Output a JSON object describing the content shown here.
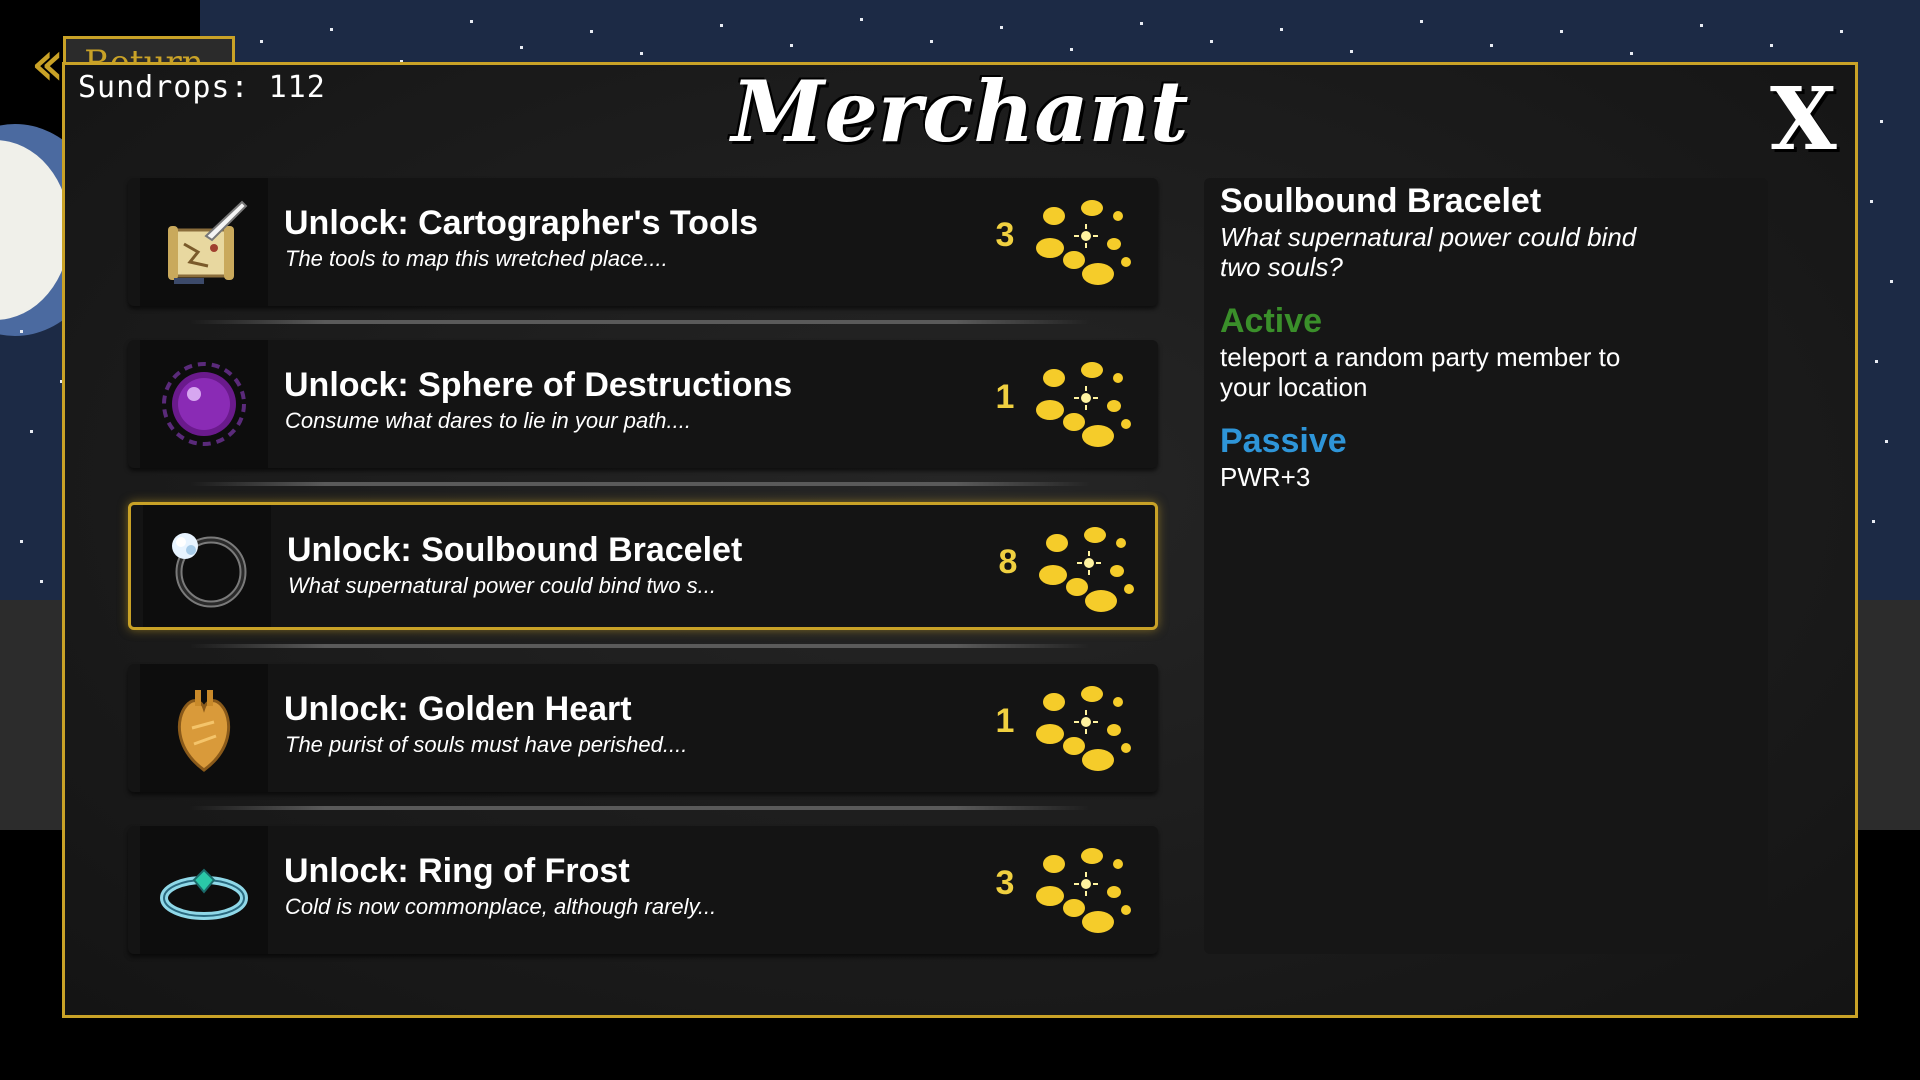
{
  "header": {
    "sundrops_label": "Sundrops: 112",
    "title": "Merchant",
    "close_label": "X"
  },
  "return_button": {
    "label": "Return"
  },
  "shop_items": [
    {
      "name": "Unlock: Cartographer's Tools",
      "description": "The tools to map this wretched place....",
      "price": "3",
      "icon": "map-and-quill-icon",
      "selected": false
    },
    {
      "name": "Unlock: Sphere of Destructions",
      "description": "Consume what dares to lie in your path....",
      "price": "1",
      "icon": "purple-orb-icon",
      "selected": false
    },
    {
      "name": "Unlock: Soulbound Bracelet",
      "description": "What supernatural power could bind two s...",
      "price": "8",
      "icon": "bracelet-icon",
      "selected": true
    },
    {
      "name": "Unlock: Golden Heart",
      "description": "The purist of souls must have perished....",
      "price": "1",
      "icon": "golden-heart-icon",
      "selected": false
    },
    {
      "name": "Unlock: Ring of Frost",
      "description": "Cold is now commonplace, although rarely...",
      "price": "3",
      "icon": "frost-ring-icon",
      "selected": false
    }
  ],
  "detail": {
    "name": "Soulbound Bracelet",
    "description": "What supernatural power could bind two souls?",
    "active_heading": "Active",
    "active_text": "teleport a random party member to your location",
    "passive_heading": "Passive",
    "passive_text": "PWR+3"
  },
  "colors": {
    "gold_border": "#c9a227",
    "price_yellow": "#f0d040",
    "active_green": "#3a8f2a",
    "passive_blue": "#2e95d8",
    "sky": "#1c2a45"
  },
  "currency_icon": "sundrop-coins-icon"
}
